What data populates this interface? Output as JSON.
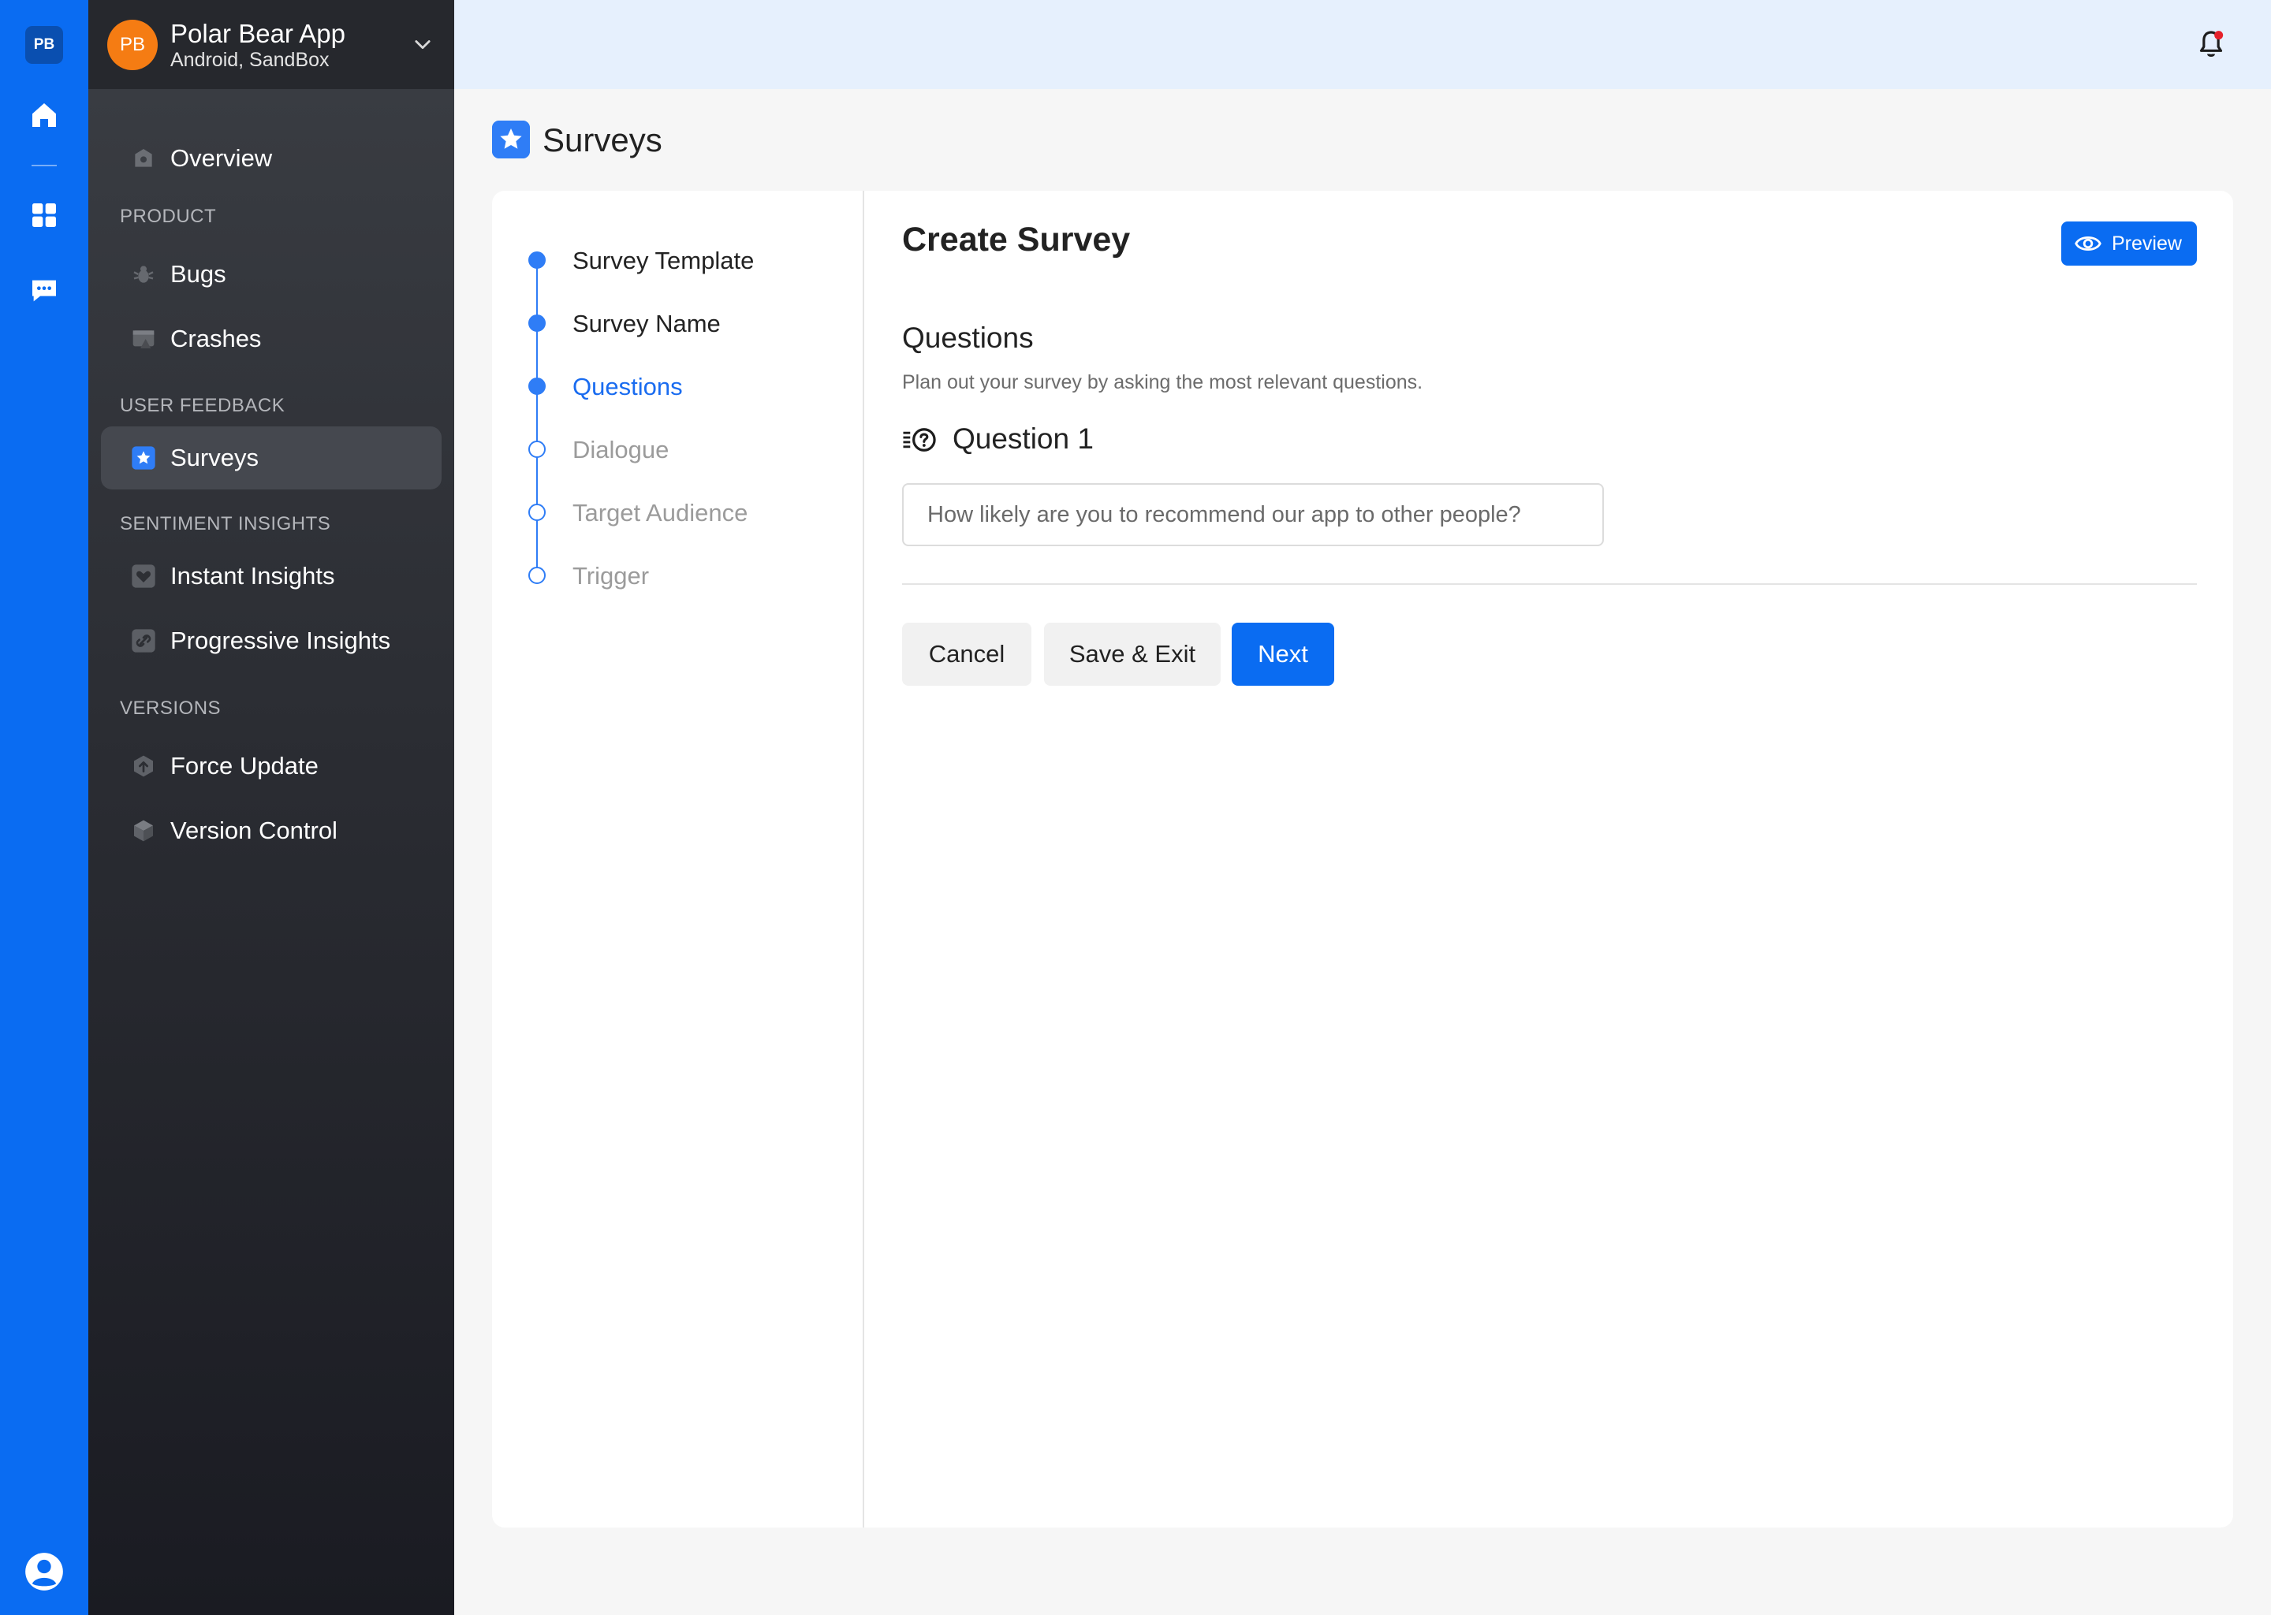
{
  "rail": {
    "badge": "PB"
  },
  "app": {
    "avatar_initials": "PB",
    "name": "Polar Bear App",
    "subtitle": "Android, SandBox"
  },
  "sidebar": {
    "overview": "Overview",
    "sections": {
      "product": "PRODUCT",
      "user_feedback": "USER FEEDBACK",
      "sentiment": "SENTIMENT INSIGHTS",
      "versions": "VERSIONS"
    },
    "items": {
      "bugs": "Bugs",
      "crashes": "Crashes",
      "surveys": "Surveys",
      "instant": "Instant Insights",
      "progressive": "Progressive Insights",
      "force_update": "Force Update",
      "version_control": "Version Control"
    }
  },
  "page": {
    "title": "Surveys"
  },
  "steps": [
    {
      "label": "Survey Template",
      "state": "done"
    },
    {
      "label": "Survey Name",
      "state": "done"
    },
    {
      "label": "Questions",
      "state": "current"
    },
    {
      "label": "Dialogue",
      "state": "future"
    },
    {
      "label": "Target Audience",
      "state": "future"
    },
    {
      "label": "Trigger",
      "state": "future"
    }
  ],
  "content": {
    "title": "Create Survey",
    "preview_label": "Preview",
    "section_title": "Questions",
    "section_desc": "Plan out your survey by asking the most relevant questions.",
    "question_title": "Question 1",
    "question_placeholder": "How likely are you to recommend our app to other people?"
  },
  "buttons": {
    "cancel": "Cancel",
    "save_exit": "Save & Exit",
    "next": "Next"
  },
  "colors": {
    "accent": "#0a6cf2",
    "avatar": "#f57c13",
    "notification_dot": "#e5212b"
  }
}
